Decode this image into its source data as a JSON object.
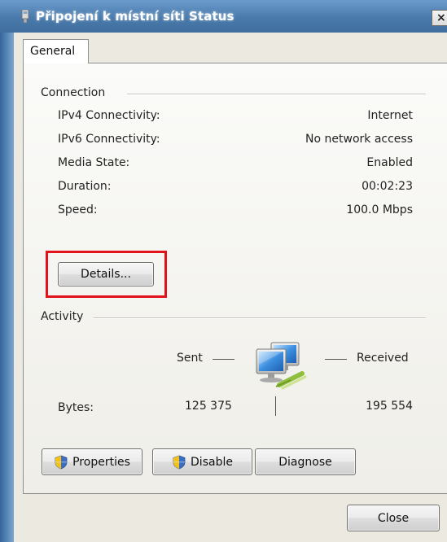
{
  "window": {
    "title": "Připojení k místní síti Status",
    "close_glyph": "×"
  },
  "tabs": [
    {
      "label": "General",
      "selected": true
    }
  ],
  "connection": {
    "group_label": "Connection",
    "rows": [
      {
        "label": "IPv4 Connectivity:",
        "value": "Internet"
      },
      {
        "label": "IPv6 Connectivity:",
        "value": "No network access"
      },
      {
        "label": "Media State:",
        "value": "Enabled"
      },
      {
        "label": "Duration:",
        "value": "00:02:23"
      },
      {
        "label": "Speed:",
        "value": "100.0 Mbps"
      }
    ],
    "details_button": "Details..."
  },
  "activity": {
    "group_label": "Activity",
    "sent_label": "Sent",
    "received_label": "Received",
    "bytes_label": "Bytes:",
    "bytes_sent": "125 375",
    "bytes_received": "195 554",
    "icon": "network-computers-icon"
  },
  "buttons": {
    "properties": "Properties",
    "disable": "Disable",
    "diagnose": "Diagnose",
    "close": "Close"
  },
  "colors": {
    "highlight_border": "#e2121b",
    "title_bar": "#4a7aab",
    "dialog_bg": "#ebe9e0"
  }
}
